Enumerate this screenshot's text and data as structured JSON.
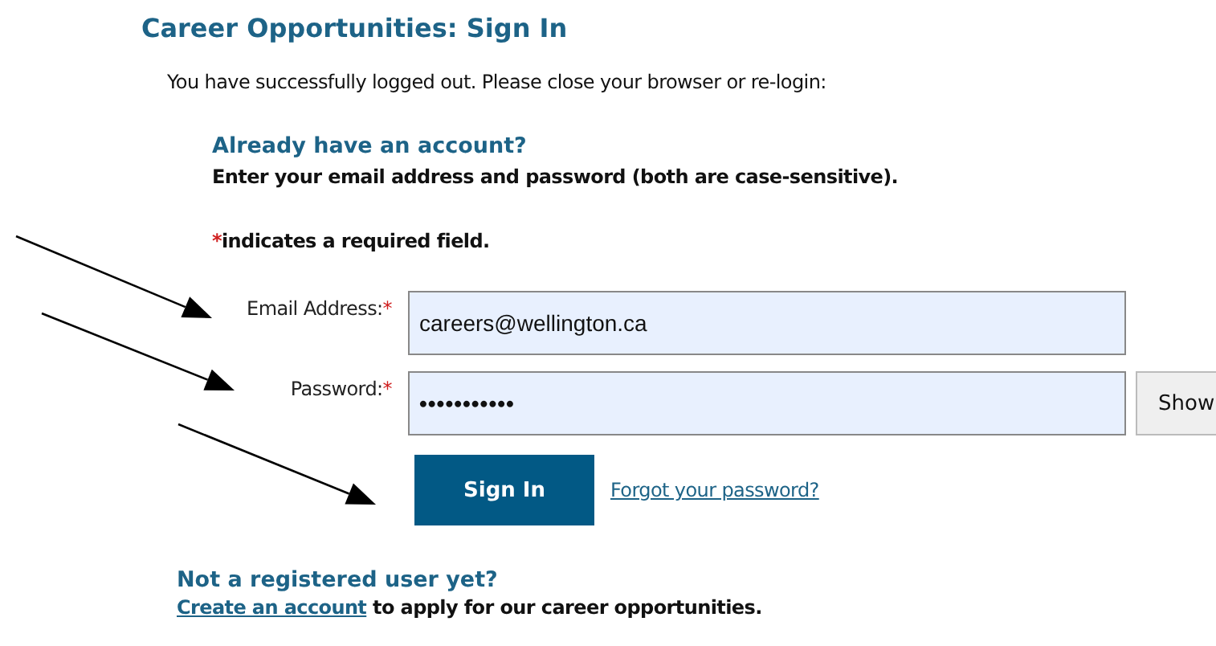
{
  "title": "Career Opportunities: Sign In",
  "message": "You have successfully logged out. Please close your browser or re-login:",
  "login": {
    "heading": "Already have an account?",
    "instructions": "Enter your email address and password (both are case-sensitive).",
    "required_mark": "*",
    "required_note": "indicates a required field.",
    "fields": [
      {
        "kind": "text",
        "label": "Email Address:",
        "required": true,
        "value": "careers@wellington.ca"
      },
      {
        "kind": "password",
        "label": "Password:",
        "required": true,
        "value": "•••••••••••",
        "button": "Show"
      }
    ],
    "submit": "Sign In",
    "forgot_link": "Forgot your password?"
  },
  "register": {
    "heading": "Not a registered user yet?",
    "link": "Create an account",
    "text": "to apply for our career opportunities."
  }
}
